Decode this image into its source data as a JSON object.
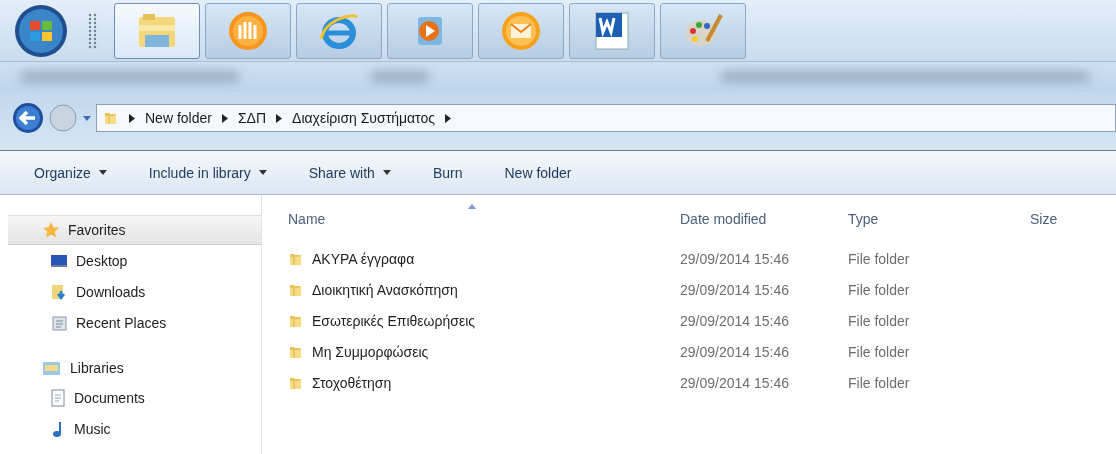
{
  "taskbar": {
    "buttons": [
      {
        "kind": "explorer",
        "selected": true
      },
      {
        "kind": "orange-app",
        "selected": false
      },
      {
        "kind": "browser",
        "selected": false
      },
      {
        "kind": "media",
        "selected": false
      },
      {
        "kind": "mail",
        "selected": false
      },
      {
        "kind": "word",
        "selected": false
      },
      {
        "kind": "paint",
        "selected": false
      }
    ]
  },
  "address_bar": {
    "path": [
      "New folder",
      "ΣΔΠ",
      "Διαχείριση Συστήματος"
    ]
  },
  "toolbar": [
    {
      "label": "Organize",
      "dropdown": true
    },
    {
      "label": "Include in library",
      "dropdown": true
    },
    {
      "label": "Share with",
      "dropdown": true
    },
    {
      "label": "Burn",
      "dropdown": false
    },
    {
      "label": "New folder",
      "dropdown": false
    }
  ],
  "sidebar": {
    "groups": [
      {
        "label": "Favorites",
        "kind": "favorites",
        "selected": true,
        "children": [
          {
            "label": "Desktop",
            "kind": "desktop"
          },
          {
            "label": "Downloads",
            "kind": "downloads"
          },
          {
            "label": "Recent Places",
            "kind": "recent"
          }
        ]
      },
      {
        "label": "Libraries",
        "kind": "libraries",
        "selected": false,
        "children": [
          {
            "label": "Documents",
            "kind": "documents"
          },
          {
            "label": "Music",
            "kind": "music"
          }
        ]
      }
    ]
  },
  "table": {
    "columns": [
      {
        "label": "Name",
        "sorted": true
      },
      {
        "label": "Date modified",
        "sorted": false
      },
      {
        "label": "Type",
        "sorted": false
      },
      {
        "label": "Size",
        "sorted": false
      }
    ],
    "rows": [
      {
        "name": "ΑΚΥΡΑ έγγραφα",
        "date": "29/09/2014 15:46",
        "type": "File folder"
      },
      {
        "name": "Διοικητική Ανασκόπηση",
        "date": "29/09/2014 15:46",
        "type": "File folder"
      },
      {
        "name": "Εσωτερικές Επιθεωρήσεις",
        "date": "29/09/2014 15:46",
        "type": "File folder"
      },
      {
        "name": "Μη Συμμορφώσεις",
        "date": "29/09/2014 15:46",
        "type": "File folder"
      },
      {
        "name": "Στοχοθέτηση",
        "date": "29/09/2014 15:46",
        "type": "File folder"
      }
    ]
  }
}
